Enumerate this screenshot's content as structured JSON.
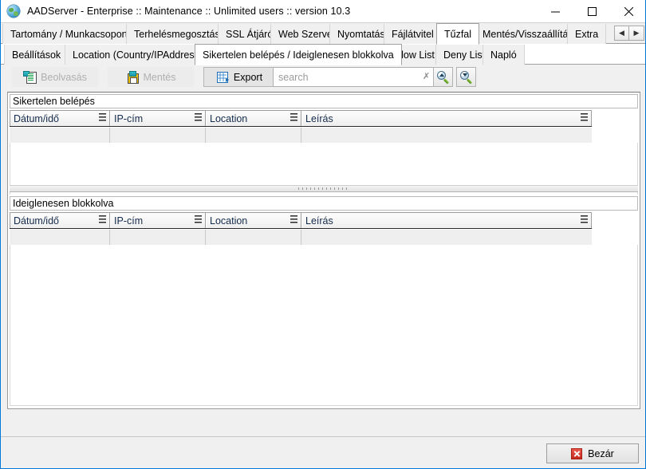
{
  "window": {
    "title": "AADServer - Enterprise :: Maintenance :: Unlimited users :: version 10.3",
    "app_icon": "globe-icon",
    "minimize_label": "—",
    "maximize_label": "□",
    "close_label": "✕"
  },
  "tabs_primary": {
    "selected": "Tűzfal",
    "items": [
      {
        "label": "Tartomány / Munkacsoport"
      },
      {
        "label": "Terhelésmegosztás"
      },
      {
        "label": "SSL Átjáró"
      },
      {
        "label": "Web Szerver"
      },
      {
        "label": "Nyomtatás"
      },
      {
        "label": "Fájlátvitel"
      },
      {
        "label": "Tűzfal"
      },
      {
        "label": "Mentés/Visszaállítás"
      },
      {
        "label": "Extra"
      }
    ],
    "nav_prev": "◀",
    "nav_next": "▶"
  },
  "tabs_secondary": {
    "selected": "Sikertelen belépés / Ideiglenesen blokkolva",
    "items": [
      {
        "label": "Beállítások"
      },
      {
        "label": "Location (Country/IPAddress)"
      },
      {
        "label": "Sikertelen belépés / Ideiglenesen blokkolva"
      },
      {
        "label": "Allow List"
      },
      {
        "label": "Deny List"
      },
      {
        "label": "Napló"
      }
    ]
  },
  "toolbar": {
    "read_label": "Beolvasás",
    "save_label": "Mentés",
    "export_label": "Export",
    "search_value": "",
    "search_placeholder": "search",
    "clear_glyph": "✗",
    "zoom_in_name": "search-up-button",
    "zoom_out_name": "search-down-button"
  },
  "grid_failed": {
    "band_title": "Sikertelen belépés",
    "columns": [
      "Dátum/idő",
      "IP-cím",
      "Location",
      "Leírás"
    ],
    "rows": []
  },
  "grid_blocked": {
    "band_title": "Ideiglenesen blokkolva",
    "columns": [
      "Dátum/idő",
      "IP-cím",
      "Location",
      "Leírás"
    ],
    "rows": []
  },
  "footer": {
    "close_label": "Bezár"
  },
  "colors": {
    "accent": "#0078d7",
    "window_bg": "#f0f0f0",
    "grid_bg": "#ffffff",
    "header_text": "#142b4a",
    "close_icon": "#c62a1c"
  }
}
